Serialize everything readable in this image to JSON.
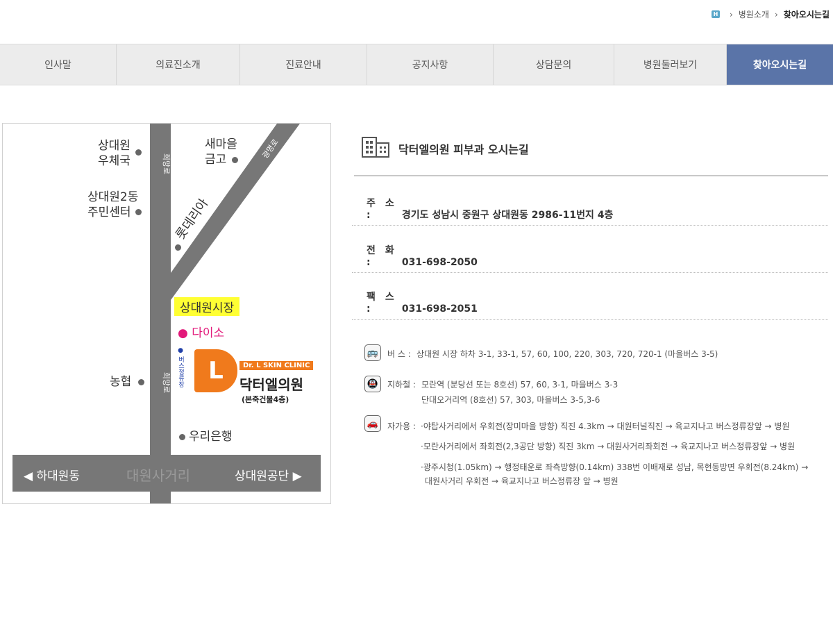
{
  "breadcrumb": {
    "home_icon": "H",
    "section": "병원소개",
    "current": "찾아오시는길"
  },
  "nav": {
    "items": [
      "인사말",
      "의료진소개",
      "진료안내",
      "공지사항",
      "상담문의",
      "병원둘러보기",
      "찾아오시는길"
    ],
    "active_index": 6,
    "active_color": "#5a74a8"
  },
  "map": {
    "labels": {
      "post_office_1": "상대원",
      "post_office_2": "우체국",
      "community_1": "상대원2동",
      "community_2": "주민센터",
      "saemaeul_1": "새마을",
      "saemaeul_2": "금고",
      "lotteria": "롯데리아",
      "road_top_left": "희망로",
      "road_diag": "광명로",
      "market": "상대원시장",
      "daiso": "● 다이소",
      "nonghyup": "농협",
      "road_mid": "희망로",
      "bus_stop": "● 버스정류장",
      "woori": "우리은행",
      "left_dest": "◀ 하대원동",
      "center": "대원사거리",
      "right_dest": "상대원공단 ▶"
    },
    "clinic": {
      "logo_letter": "L",
      "name_en": "Dr. L SKIN CLINIC",
      "name_ko": "닥터엘의원",
      "sub": "(본죽건물4층)"
    }
  },
  "info": {
    "title": "닥터엘의원 피부과 오시는길",
    "address_label": "주　소 :",
    "address": "경기도 성남시 중원구 상대원동 2986-11번지 4층",
    "phone_label": "전　화 :",
    "phone": "031-698-2050",
    "fax_label": "팩　스 :",
    "fax": "031-698-2051"
  },
  "transport": {
    "bus_label": "버 스 :",
    "bus": "상대원 시장 하차 3-1, 33-1, 57, 60, 100, 220, 303, 720, 720-1 (마을버스 3-5)",
    "subway_label": "지하철 :",
    "subway_1": "모란역 (분당선 또는 8호선) 57, 60, 3-1, 마을버스 3-3",
    "subway_2": "단대오거리역 (8호선) 57, 303, 마을버스 3-5,3-6",
    "car_label": "자가용 :",
    "car_1": "·야탑사거리에서 우회전(장미마을 방향) 직진 4.3km → 대원터널직진 → 육교지나고 버스정류장앞 → 병원",
    "car_2": "·모란사거리에서 좌회전(2,3공단 방향) 직진 3km → 대원사거리좌회전 → 육교지나고 버스정류장앞 → 병원",
    "car_3a": "·광주시청(1.05km) → 행정태운로 좌측방향(0.14km) 338번 이배재로 성남, 목현동방면 우회전(8.24km) →",
    "car_3b": "대원사거리 우회전 → 육교지나고 버스정류장 앞 → 병원"
  }
}
